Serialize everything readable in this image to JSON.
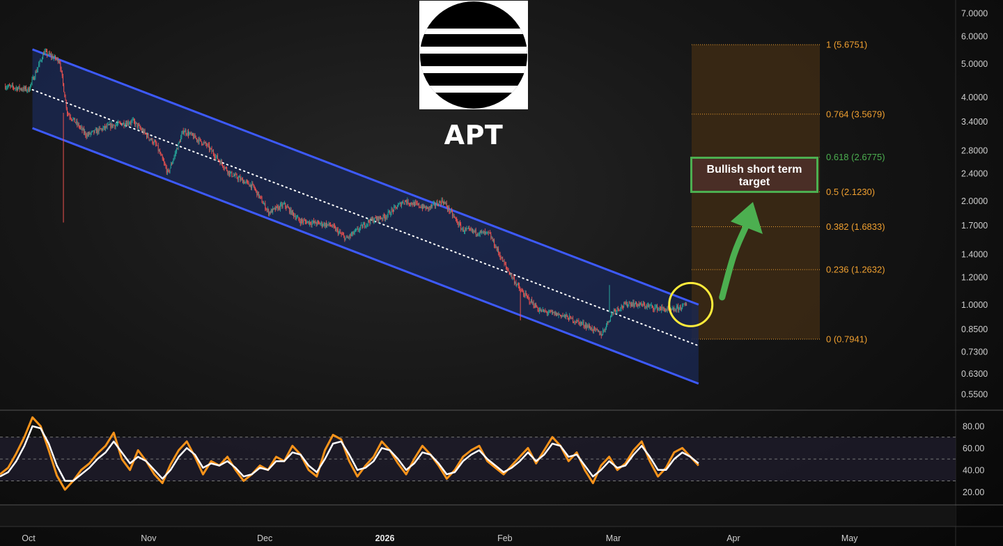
{
  "symbol": "APT",
  "annotation": "Bullish short term\ntarget",
  "colors": {
    "background": "#121212",
    "channel_line": "#3d5afe",
    "channel_fill": "#1a2750",
    "up_candle": "#26a69a",
    "down_candle": "#ef5350",
    "fib": "#f0a030",
    "fib_highlight": "#4caf50",
    "fib_fill": "#3d2a14",
    "rsi": "#f7931a",
    "rsi_ma": "#ffffff",
    "circle": "#ffeb3b",
    "arrow": "#4caf50"
  },
  "chart_data": [
    {
      "type": "candlestick",
      "price_scale": "log",
      "price_ticks": [
        "7.0000",
        "6.0000",
        "5.0000",
        "4.0000",
        "3.4000",
        "2.8000",
        "2.4000",
        "2.0000",
        "1.7000",
        "1.4000",
        "1.2000",
        "1.0000",
        "0.8500",
        "0.7300",
        "0.6300",
        "0.5500"
      ],
      "x_ticks": [
        "Oct",
        "Nov",
        "Dec",
        "2026",
        "Feb",
        "Mar",
        "Apr",
        "May"
      ],
      "ylim": [
        0.52,
        7.3
      ],
      "price_path": [
        {
          "t": "Sep 25",
          "v": 4.3
        },
        {
          "t": "Oct 1",
          "v": 4.2
        },
        {
          "t": "Oct 5",
          "v": 5.4
        },
        {
          "t": "Oct 9",
          "v": 5.1
        },
        {
          "t": "Oct 11",
          "v": 3.6
        },
        {
          "t": "Oct 16",
          "v": 3.1
        },
        {
          "t": "Oct 22",
          "v": 3.3
        },
        {
          "t": "Oct 28",
          "v": 3.4
        },
        {
          "t": "Nov 3",
          "v": 2.9
        },
        {
          "t": "Nov 6",
          "v": 2.4
        },
        {
          "t": "Nov 10",
          "v": 3.2
        },
        {
          "t": "Nov 16",
          "v": 2.9
        },
        {
          "t": "Nov 22",
          "v": 2.4
        },
        {
          "t": "Nov 28",
          "v": 2.2
        },
        {
          "t": "Dec 2",
          "v": 1.85
        },
        {
          "t": "Dec 6",
          "v": 1.95
        },
        {
          "t": "Dec 10",
          "v": 1.75
        },
        {
          "t": "Dec 18",
          "v": 1.7
        },
        {
          "t": "Dec 22",
          "v": 1.55
        },
        {
          "t": "Dec 28",
          "v": 1.75
        },
        {
          "t": "Jan 1",
          "v": 1.8
        },
        {
          "t": "Jan 6",
          "v": 2.0
        },
        {
          "t": "Jan 12",
          "v": 1.9
        },
        {
          "t": "Jan 16",
          "v": 2.0
        },
        {
          "t": "Jan 21",
          "v": 1.65
        },
        {
          "t": "Jan 28",
          "v": 1.6
        },
        {
          "t": "Feb 1",
          "v": 1.3
        },
        {
          "t": "Feb 5",
          "v": 1.1
        },
        {
          "t": "Feb 10",
          "v": 0.96
        },
        {
          "t": "Feb 16",
          "v": 0.93
        },
        {
          "t": "Feb 22",
          "v": 0.87
        },
        {
          "t": "Feb 26",
          "v": 0.82
        },
        {
          "t": "Mar 1",
          "v": 0.96
        },
        {
          "t": "Mar 5",
          "v": 1.01
        },
        {
          "t": "Mar 10",
          "v": 0.99
        },
        {
          "t": "Mar 16",
          "v": 0.96
        },
        {
          "t": "Mar 20",
          "v": 1.0
        }
      ],
      "channel": {
        "upper": [
          {
            "t": "Oct 2",
            "v": 5.5
          },
          {
            "t": "Mar 23",
            "v": 1.0
          }
        ],
        "middle": [
          {
            "t": "Oct 2",
            "v": 4.2
          },
          {
            "t": "Mar 23",
            "v": 0.76
          }
        ],
        "lower": [
          {
            "t": "Oct 2",
            "v": 3.25
          },
          {
            "t": "Mar 23",
            "v": 0.59
          }
        ]
      },
      "fib_levels": [
        {
          "ratio": "1",
          "value": "5.6751",
          "label": "1 (5.6751)"
        },
        {
          "ratio": "0.764",
          "value": "3.5679",
          "label": "0.764 (3.5679)"
        },
        {
          "ratio": "0.618",
          "value": "2.6775",
          "label": "0.618 (2.6775)"
        },
        {
          "ratio": "0.5",
          "value": "2.1230",
          "label": "0.5 (2.1230)"
        },
        {
          "ratio": "0.382",
          "value": "1.6833",
          "label": "0.382 (1.6833)"
        },
        {
          "ratio": "0.236",
          "value": "1.2632",
          "label": "0.236 (1.2632)"
        },
        {
          "ratio": "0",
          "value": "0.7941",
          "label": "0 (0.7941)"
        }
      ]
    },
    {
      "type": "line",
      "panel": "RSI",
      "y_ticks": [
        "80.00",
        "60.00",
        "40.00",
        "20.00"
      ],
      "ylim": [
        10,
        92
      ],
      "bands": [
        70,
        50,
        30
      ],
      "series": [
        {
          "color": "#f7931a",
          "values": [
            36,
            42,
            55,
            70,
            88,
            80,
            58,
            35,
            22,
            30,
            40,
            46,
            55,
            62,
            74,
            50,
            40,
            58,
            48,
            36,
            28,
            45,
            58,
            66,
            52,
            36,
            48,
            44,
            52,
            40,
            30,
            36,
            44,
            40,
            52,
            48,
            62,
            54,
            40,
            34,
            58,
            72,
            68,
            48,
            34,
            44,
            52,
            66,
            58,
            46,
            36,
            50,
            62,
            54,
            44,
            32,
            40,
            52,
            58,
            62,
            48,
            42,
            36,
            44,
            52,
            60,
            46,
            58,
            70,
            62,
            48,
            56,
            40,
            28,
            44,
            52,
            40,
            46,
            58,
            66,
            48,
            34,
            42,
            56,
            60,
            52,
            44
          ]
        },
        {
          "color": "#ffffff",
          "values": [
            34,
            38,
            48,
            62,
            80,
            78,
            64,
            44,
            30,
            30,
            36,
            42,
            50,
            56,
            66,
            56,
            46,
            52,
            48,
            40,
            32,
            40,
            52,
            60,
            54,
            42,
            46,
            44,
            48,
            42,
            34,
            36,
            42,
            40,
            48,
            48,
            56,
            54,
            44,
            38,
            50,
            64,
            66,
            54,
            40,
            42,
            48,
            60,
            58,
            50,
            40,
            46,
            56,
            54,
            46,
            36,
            38,
            48,
            54,
            58,
            50,
            44,
            38,
            42,
            48,
            56,
            48,
            54,
            64,
            62,
            52,
            54,
            44,
            34,
            40,
            48,
            42,
            44,
            54,
            62,
            52,
            40,
            40,
            50,
            56,
            52,
            46
          ]
        }
      ]
    }
  ]
}
